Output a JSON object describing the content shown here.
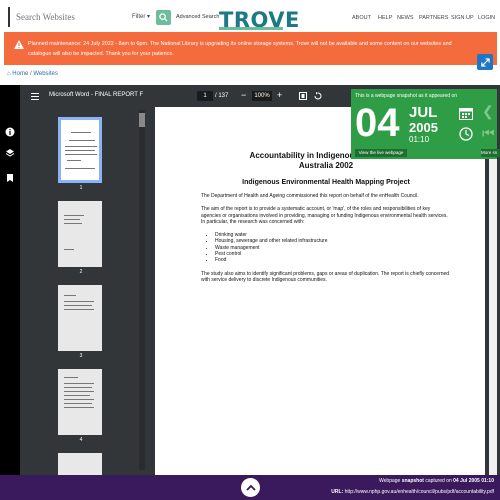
{
  "header": {
    "search_placeholder": "Search Websites",
    "filter_label": "Filter",
    "advanced_search": "Advanced Search",
    "logo": "TROVE",
    "nav": [
      "ABOUT",
      "HELP",
      "NEWS",
      "PARTNERS",
      "SIGN UP",
      "LOGIN"
    ]
  },
  "notice": {
    "text": "Planned maintenance: 24 July 2022 - 8am to 6pm. The National Library is upgrading its online storage systems. Trove will not be available and some content on our websites and catalogue will also be impacted. Thank you for your patience.",
    "bg_color": "#f46b3e"
  },
  "breadcrumb": {
    "home": "Home",
    "sep": "/",
    "current": "Websites"
  },
  "pdf": {
    "title": "Microsoft Word - FINAL REPORT F",
    "page": "1",
    "total": "/ 137",
    "zoom": "100%",
    "thumb_numbers": [
      "1",
      "2",
      "3",
      "4"
    ]
  },
  "document": {
    "title_line1": "Accountability in Indigenous Environme",
    "title_line2": "Australia 2002",
    "subtitle": "Indigenous Environmental Health Mapping Project",
    "para1": "The Department of Health and Ageing commissioned this report on behalf of the enHealth Council.",
    "para2": "The aim of the report is to provide a systematic account, or 'map', of the roles and responsibilities of key agencies or organisations involved in providing, managing or funding Indigenous environmental health services. In particular, the research was concerned with:",
    "bullets": [
      "Drinking water",
      "Housing, sewerage and other related infrastructure",
      "Waste management",
      "Pest control",
      "Food"
    ],
    "para3": "The study also aims to identify significant problems, gaps or areas of duplication. The report is chiefly concerned with service delivery to discrete Indigenous communities."
  },
  "snapshot": {
    "heading": "This is a webpage snapshot as it appeared on",
    "day": "04",
    "month": "JUL",
    "year": "2005",
    "time": "01:10",
    "live_button": "View the live webpage",
    "more_button": "More sn",
    "bg_color": "#2f9c46"
  },
  "footer": {
    "line1_prefix": "Webpage ",
    "line1_bold": "snapshot",
    "line1_suffix": " captured on ",
    "line1_date": "04 Jul 2005 01:10",
    "url_label": "URL:",
    "url": "http://www.nphp.gov.au/enhealth/council/pubs/pdf/accountability.pdf",
    "bg_color": "#3a1a5c"
  }
}
